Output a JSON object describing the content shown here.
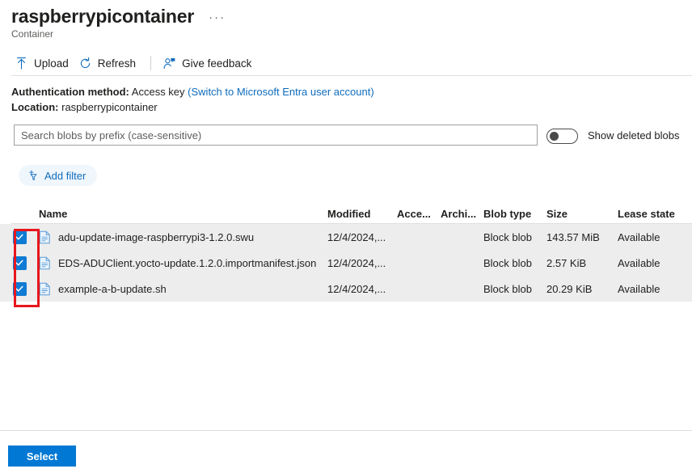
{
  "header": {
    "title": "raspberrypicontainer",
    "ellipsis": "···",
    "subtitle": "Container"
  },
  "toolbar": {
    "upload_label": "Upload",
    "refresh_label": "Refresh",
    "feedback_label": "Give feedback"
  },
  "info": {
    "auth_label": "Authentication method:",
    "auth_value": "Access key",
    "auth_link": "(Switch to Microsoft Entra user account)",
    "location_label": "Location:",
    "location_value": "raspberrypicontainer"
  },
  "search": {
    "value": "",
    "placeholder": "Search blobs by prefix (case-sensitive)"
  },
  "deleted_toggle": {
    "label": "Show deleted blobs",
    "state": "off"
  },
  "filter": {
    "add_filter_label": "Add filter"
  },
  "table": {
    "columns": [
      "Name",
      "Modified",
      "Acce...",
      "Archi...",
      "Blob type",
      "Size",
      "Lease state"
    ],
    "rows": [
      {
        "selected": true,
        "name": "adu-update-image-raspberrypi3-1.2.0.swu",
        "modified": "12/4/2024,...",
        "access_tier": "",
        "archive_status": "",
        "blob_type": "Block blob",
        "size": "143.57 MiB",
        "lease_state": "Available"
      },
      {
        "selected": true,
        "name": "EDS-ADUClient.yocto-update.1.2.0.importmanifest.json",
        "modified": "12/4/2024,...",
        "access_tier": "",
        "archive_status": "",
        "blob_type": "Block blob",
        "size": "2.57 KiB",
        "lease_state": "Available"
      },
      {
        "selected": true,
        "name": "example-a-b-update.sh",
        "modified": "12/4/2024,...",
        "access_tier": "",
        "archive_status": "",
        "blob_type": "Block blob",
        "size": "20.29 KiB",
        "lease_state": "Available"
      }
    ]
  },
  "footer": {
    "select_label": "Select"
  },
  "colors": {
    "accent_blue": "#0078d4",
    "link_blue": "#0f6cbd",
    "checkbox_blue": "#0f7bd4",
    "row_selected_bg": "#ededed",
    "annotation_red": "#e8161d"
  }
}
